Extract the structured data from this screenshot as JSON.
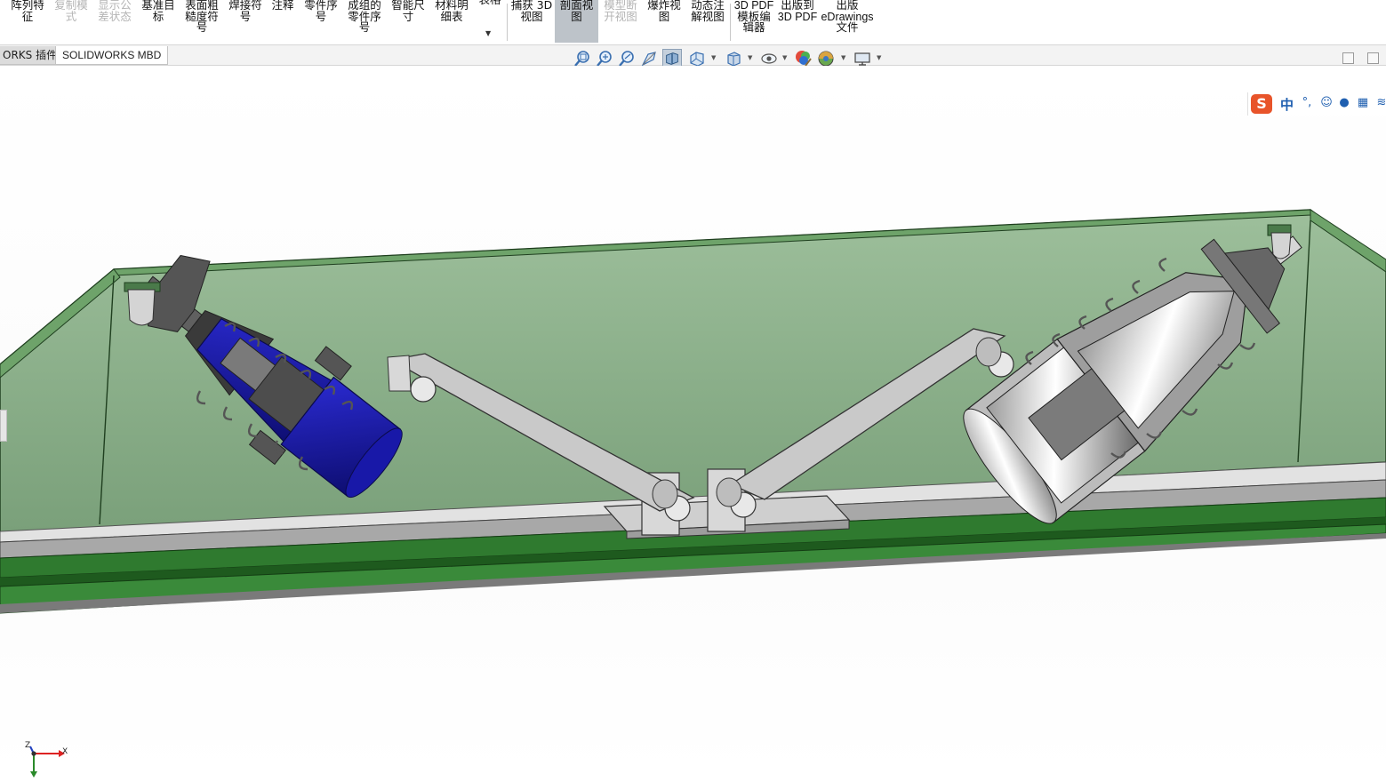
{
  "ribbon": {
    "buttons": [
      {
        "label": "阵列特\n征",
        "enabled": true
      },
      {
        "label": "复制模\n式",
        "enabled": false
      },
      {
        "label": "显示公\n差状态",
        "enabled": false
      },
      {
        "label": "基准目\n标",
        "enabled": true
      },
      {
        "label": "表面粗\n糙度符\n号",
        "enabled": true
      },
      {
        "label": "焊接符\n号",
        "enabled": true
      },
      {
        "label": "注释",
        "enabled": true
      },
      {
        "label": "零件序\n号",
        "enabled": true
      },
      {
        "label": "成组的\n零件序\n号",
        "enabled": true
      },
      {
        "label": "智能尺\n寸",
        "enabled": true
      },
      {
        "label": "材料明\n细表",
        "enabled": true
      },
      {
        "label": "表格",
        "enabled": true
      },
      {
        "label": "捕获 3D\n视图",
        "enabled": true
      },
      {
        "label": "剖面视\n图",
        "enabled": true,
        "active": true
      },
      {
        "label": "模型断\n开视图",
        "enabled": false
      },
      {
        "label": "爆炸视\n图",
        "enabled": true
      },
      {
        "label": "动态注\n解视图",
        "enabled": true
      },
      {
        "label": "3D PDF\n模板编\n辑器",
        "enabled": true
      },
      {
        "label": "出版到\n3D PDF",
        "enabled": true
      },
      {
        "label": "出版\neDrawings\n文件",
        "enabled": true
      }
    ]
  },
  "tabs": [
    {
      "label": "ORKS 插件"
    },
    {
      "label": "SOLIDWORKS MBD"
    }
  ],
  "heads_up_toolbar": {
    "icons": [
      "zoom-to-fit-icon",
      "zoom-to-area-icon",
      "previous-view-icon",
      "section-view-icon",
      "dynamic-annotation-icon",
      "view-orientation-icon",
      "display-style-icon",
      "hide-show-items-icon",
      "edit-appearance-icon",
      "apply-scene-icon",
      "view-settings-icon"
    ]
  },
  "ime_bar": {
    "logo": "S",
    "mode": "中",
    "icons": [
      "punctuation-icon",
      "emoji-icon",
      "microphone-icon",
      "keyboard-icon",
      "skin-icon"
    ]
  },
  "triad": {
    "labels": {
      "z": "Z",
      "x": "X",
      "y": "Y"
    }
  },
  "colors": {
    "container_glass": "#8db08f",
    "blue_part": "#1a1a9a",
    "base_green": "#2f7a2f",
    "link_gray": "#c9c9c9",
    "ribbon_active": "#bdc3c9"
  }
}
